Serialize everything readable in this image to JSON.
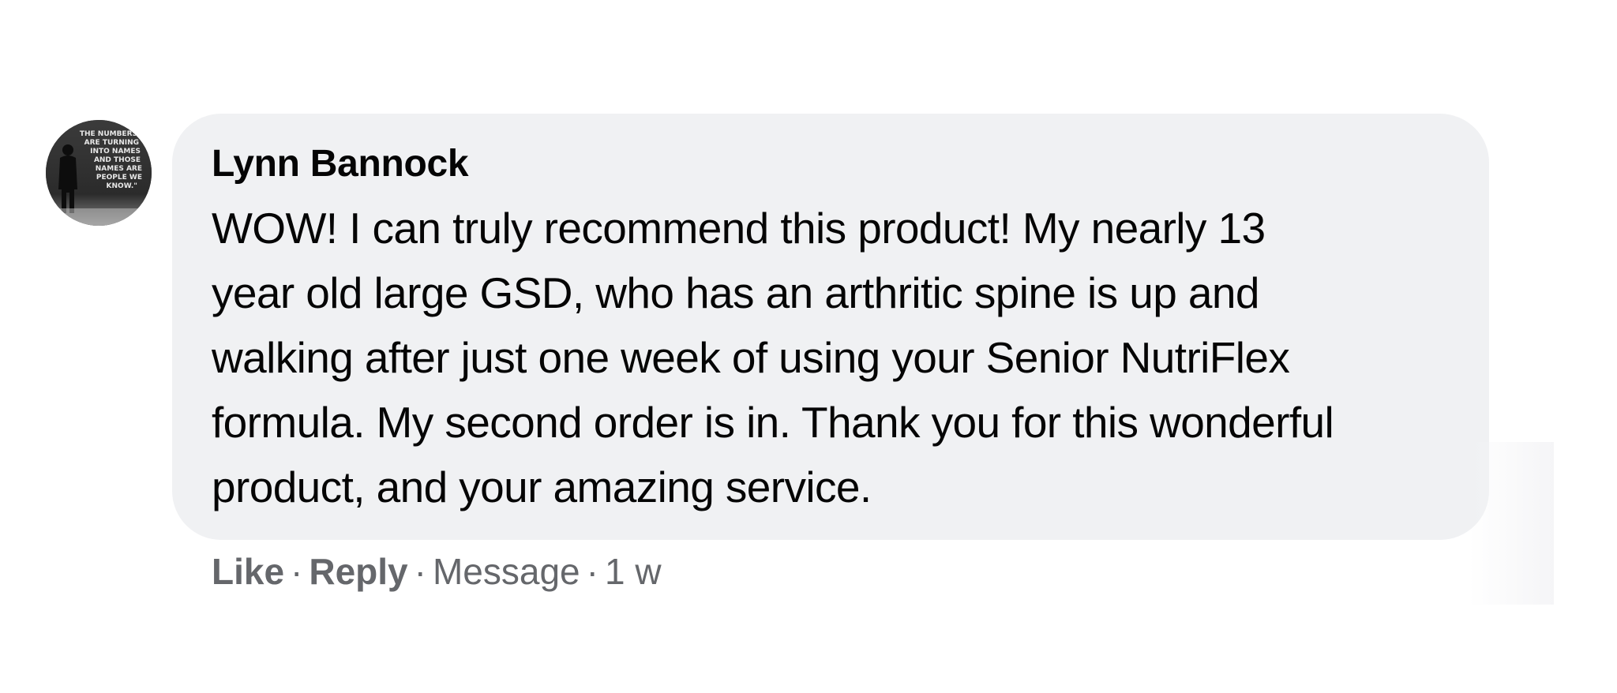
{
  "comment": {
    "author": "Lynn Bannock",
    "text": "WOW! I can truly recommend this product! My nearly 13\nyear old large GSD, who has an arthritic spine is up and\nwalking after just one week of using your Senior NutriFlex\nformula. My second order is in. Thank you for this wonderful\nproduct, and your amazing service.",
    "avatar_text": "THE NUMBERS ARE TURNING INTO NAMES AND THOSE NAMES ARE PEOPLE WE KNOW.",
    "actions": {
      "like_label": "Like",
      "reply_label": "Reply",
      "message_label": "Message",
      "separator": "·",
      "timestamp": "1 w"
    }
  },
  "colors": {
    "bubble_bg": "#f0f1f3",
    "text": "#050505",
    "meta_text": "#65676b"
  }
}
